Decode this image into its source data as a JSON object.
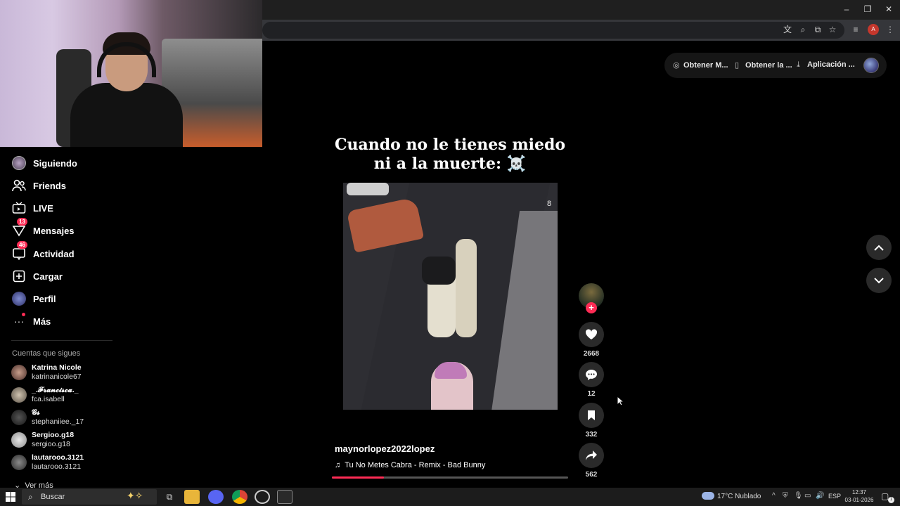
{
  "window": {
    "minimize_label": "–",
    "restore_label": "❐",
    "close_label": "✕"
  },
  "browser_toolbar": {
    "profile_initial": "A"
  },
  "top_actions": {
    "obtain_coins_label": "Obtener M...",
    "get_app_label": "Obtener la ...",
    "app_download_label": "Aplicación ..."
  },
  "sidebar": {
    "items": [
      {
        "label": "Siguiendo",
        "icon": "following-avatar-icon"
      },
      {
        "label": "Friends",
        "icon": "friends-icon"
      },
      {
        "label": "LIVE",
        "icon": "live-icon"
      },
      {
        "label": "Mensajes",
        "icon": "messages-icon",
        "badge": "13"
      },
      {
        "label": "Actividad",
        "icon": "activity-icon",
        "badge": "46"
      },
      {
        "label": "Cargar",
        "icon": "upload-icon"
      },
      {
        "label": "Perfil",
        "icon": "profile-avatar-icon"
      },
      {
        "label": "Más",
        "icon": "more-icon"
      }
    ],
    "following_title": "Cuentas que sigues",
    "accounts": [
      {
        "name": "Katrina Nicole",
        "username": "katrinanicole67"
      },
      {
        "name": "_.𝓕𝓻𝓪𝓷𝓬𝓲𝓼𝓬𝓪._",
        "username": "fca.isabell"
      },
      {
        "name": "𝓖𝓼",
        "username": "stephaniiee._17"
      },
      {
        "name": "Sergioo.g18",
        "username": "sergioo.g18"
      },
      {
        "name": "lautarooo.3121",
        "username": "lautarooo.3121"
      }
    ],
    "see_more": "Ver más"
  },
  "video": {
    "caption_line1": "Cuando no le tienes miedo",
    "caption_line2": "ni a la muerte: ☠️",
    "watermark": "8",
    "author": "maynorlopez2022lopez",
    "music": "Tu No Metes Cabra - Remix - Bad Bunny",
    "progress_fraction": 0.22
  },
  "actions": {
    "likes": "2668",
    "comments": "12",
    "saves": "332",
    "shares": "562"
  },
  "taskbar": {
    "search_placeholder": "Buscar",
    "weather": "17°C  Nublado",
    "language": "ESP",
    "time": "12:37",
    "date": "03-01-2026",
    "notification_count": "1"
  },
  "colors": {
    "accent": "#fe2c55",
    "background": "#000000",
    "button_bg": "#2a2a2a"
  }
}
